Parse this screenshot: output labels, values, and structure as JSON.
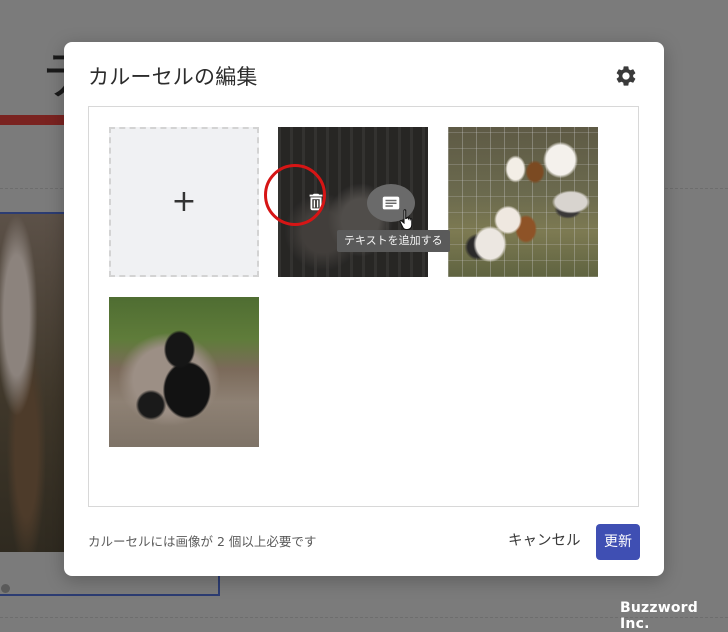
{
  "background": {
    "title_fragment": "テ"
  },
  "modal": {
    "title": "カルーセルの編集",
    "settings_icon": "gear-icon",
    "add_tile": {
      "symbol": "+"
    },
    "images": [
      {
        "alt": "",
        "state": "hover"
      },
      {
        "alt": ""
      },
      {
        "alt": ""
      }
    ],
    "tooltip": "テキストを追加する",
    "footer_note": "カルーセルには画像が 2 個以上必要です",
    "cancel_label": "キャンセル",
    "update_label": "更新",
    "accent_color": "#3f4fb3"
  },
  "watermark": "Buzzword Inc."
}
